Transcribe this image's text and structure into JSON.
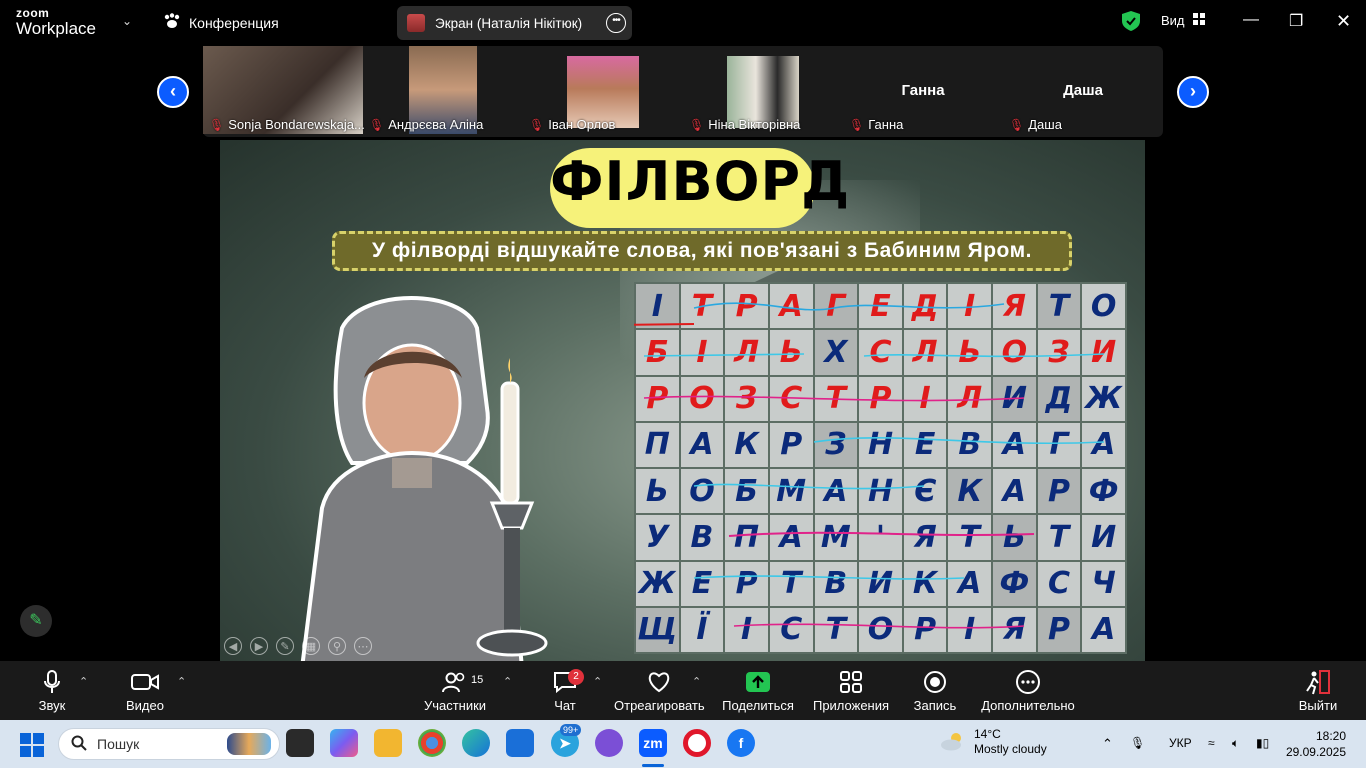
{
  "app": {
    "logo_top": "zoom",
    "logo_bottom": "Workplace"
  },
  "topbar": {
    "conference_label": "Конференция",
    "screen_share_label": "Экран (Наталія Нікітюк)",
    "view_label": "Вид"
  },
  "participants": [
    {
      "name": "Sonja Bondarewskaja..."
    },
    {
      "name": "Андрєєва Аліна"
    },
    {
      "name": "Іван Орлов"
    },
    {
      "name": "Ніна Вікторівна"
    },
    {
      "name": "Ганна",
      "placeholder": "Ганна"
    },
    {
      "name": "Даша",
      "placeholder": "Даша"
    }
  ],
  "slide": {
    "title": "ФІЛВОРД",
    "subtitle": "У філворді відшукайте слова, які пов'язані з Бабиним Яром.",
    "grid": [
      [
        "І",
        "Т",
        "Р",
        "А",
        "Г",
        "Е",
        "Д",
        "І",
        "Я",
        "Т",
        "О"
      ],
      [
        "Б",
        "І",
        "Л",
        "Ь",
        "Х",
        "С",
        "Л",
        "Ь",
        "О",
        "З",
        "И"
      ],
      [
        "Р",
        "О",
        "З",
        "С",
        "Т",
        "Р",
        "І",
        "Л",
        "И",
        "Д",
        "Ж"
      ],
      [
        "П",
        "А",
        "К",
        "Р",
        "З",
        "Н",
        "Е",
        "В",
        "А",
        "Г",
        "А"
      ],
      [
        "Ь",
        "О",
        "Б",
        "М",
        "А",
        "Н",
        "Є",
        "К",
        "А",
        "Р",
        "Ф"
      ],
      [
        "У",
        "В",
        "П",
        "А",
        "М",
        "'",
        "Я",
        "Т",
        "Ь",
        "Т",
        "И"
      ],
      [
        "Ж",
        "Е",
        "Р",
        "Т",
        "В",
        "И",
        "К",
        "А",
        "Ф",
        "С",
        "Ч"
      ],
      [
        "Щ",
        "Ї",
        "І",
        "С",
        "Т",
        "О",
        "Р",
        "І",
        "Я",
        "Р",
        "А"
      ]
    ]
  },
  "toolbar": {
    "audio": "Звук",
    "video": "Видео",
    "participants": "Участники",
    "participants_count": "15",
    "chat": "Чат",
    "chat_badge": "2",
    "react": "Отреагировать",
    "share": "Поделиться",
    "apps": "Приложения",
    "record": "Запись",
    "more": "Дополнительно",
    "leave": "Выйти"
  },
  "taskbar": {
    "search_placeholder": "Пошук",
    "telegram_badge": "99+",
    "weather_temp": "14°C",
    "weather_desc": "Mostly cloudy",
    "lang": "УКР",
    "time": "18:20",
    "date": "29.09.2025"
  },
  "colors": {
    "accent": "#0b5cff",
    "mute_red": "#e0313b",
    "grid_red": "#e01b1b",
    "grid_blue": "#0b2a7a"
  }
}
